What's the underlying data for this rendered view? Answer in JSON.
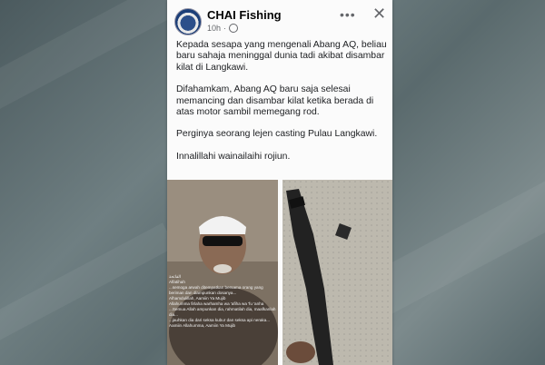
{
  "post": {
    "page_name": "CHAI Fishing",
    "time": "10h",
    "more_label": "•••",
    "close_label": "✕",
    "paragraphs": [
      "Kepada sesapa yang mengenali Abang AQ, beliau baru sahaja meninggal dunia tadi akibat disambar kilat di Langkawi.",
      "Difahamkam, Abang AQ baru saja selesai memancing dan disambar kilat ketika berada di atas motor sambil memegang rod.",
      "Perginya seorang lejen casting Pulau Langkawi.",
      "Innalillahi wainailaihi rojiun."
    ]
  },
  "media": {
    "left_caption": "الفاتحة\nAlfatihah\n...semoga arwah ditempatkan bersama orang yang beriman dan diampunkan dosanya...\nAlhamdulillah, Aamiin Ya Mujib\nAllahumma firlaha warhamha wa 'afiha wa 'fu 'anha\n...Semua Allah ampunkan dia, rahmatilah dia, maafkanlah dia...\n...jauhkan dia dari seksa kubur dan seksa api neraka...\nAamiin Allahumma, Aamiin Ya Mujib"
  },
  "icons": {
    "avatar": "page-logo",
    "more": "more-options-icon",
    "close": "close-icon",
    "audience": "globe-icon"
  }
}
